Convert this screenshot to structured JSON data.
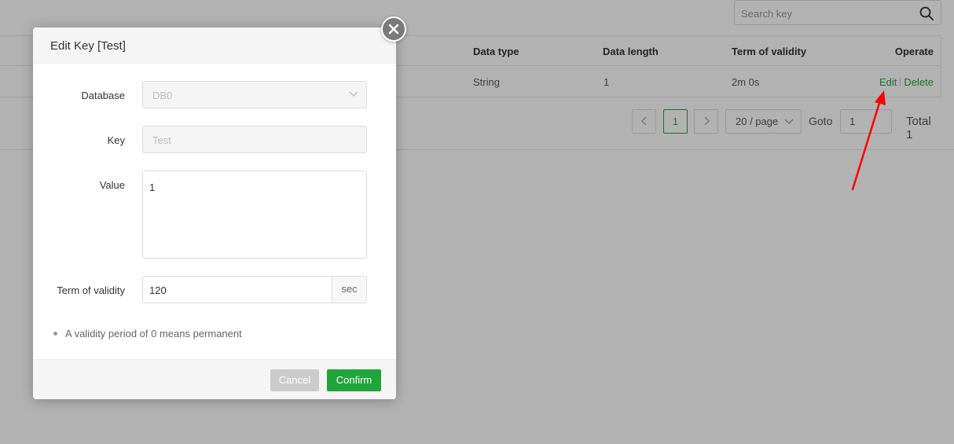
{
  "search": {
    "placeholder": "Search key"
  },
  "table": {
    "headers": {
      "data_type": "Data type",
      "data_length": "Data length",
      "term_of_validity": "Term of validity",
      "operate": "Operate"
    },
    "rows": [
      {
        "data_type": "String",
        "data_length": "1",
        "term_of_validity": "2m 0s",
        "edit_label": "Edit",
        "delete_label": "Delete"
      }
    ]
  },
  "pagination": {
    "prev_icon": "chevron-left-icon",
    "current_page": "1",
    "next_icon": "chevron-right-icon",
    "page_size": "20 / page",
    "goto_label": "Goto",
    "goto_value": "1",
    "total": "Total 1"
  },
  "dialog": {
    "title": "Edit Key [Test]",
    "close_icon": "close-icon",
    "fields": {
      "database": {
        "label": "Database",
        "value": "DB0"
      },
      "key": {
        "label": "Key",
        "value": "Test"
      },
      "value": {
        "label": "Value",
        "value": "1"
      },
      "term": {
        "label": "Term of validity",
        "value": "120",
        "unit": "sec"
      }
    },
    "tip": "A validity period of 0 means permanent",
    "cancel_label": "Cancel",
    "confirm_label": "Confirm"
  },
  "colors": {
    "accent": "#20a53a",
    "overlay": "rgba(0,0,0,0.3)",
    "annotation_arrow": "#ff0000",
    "cancel_button": "#cbcbcb"
  }
}
